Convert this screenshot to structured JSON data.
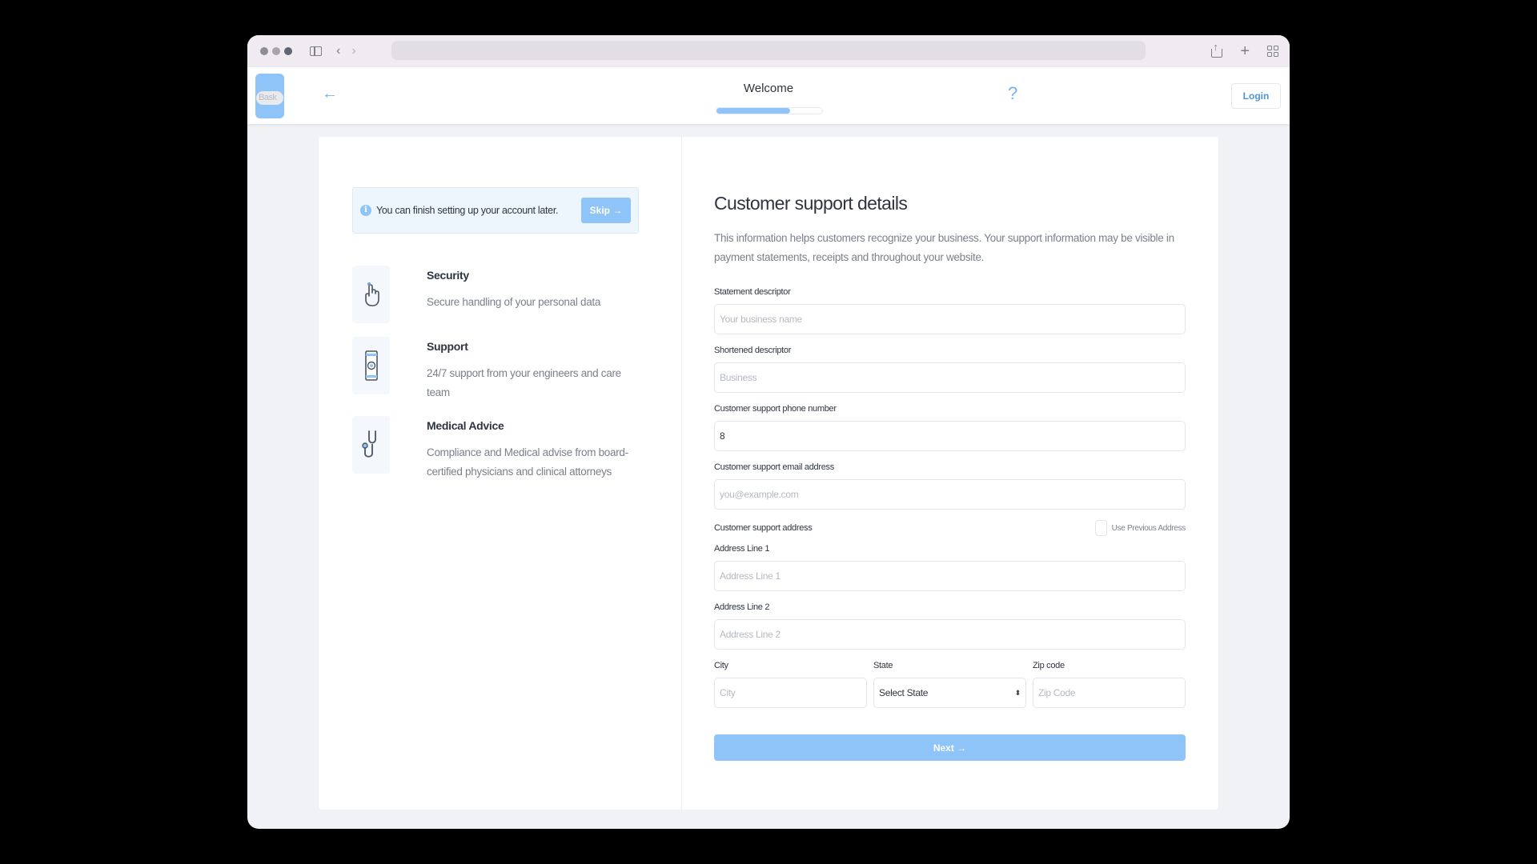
{
  "browser": {
    "toolbar_icons": [
      "sidebar-toggle-icon",
      "back-chevron-icon",
      "forward-chevron-icon",
      "share-icon",
      "new-tab-icon",
      "tab-overview-icon"
    ]
  },
  "header": {
    "logo_text": "Bask",
    "back_icon": "←",
    "title": "Welcome",
    "progress_percent": 70,
    "help_icon": "?",
    "login_label": "Login"
  },
  "left_panel": {
    "notice": {
      "icon": "i",
      "text": "You can finish setting up your account later.",
      "skip_label": "Skip →"
    },
    "features": [
      {
        "icon": "finger-touch-icon",
        "title": "Security",
        "description": "Secure handling of your personal data"
      },
      {
        "icon": "smartphone-icon",
        "title": "Support",
        "description": "24/7 support from your engineers and care team"
      },
      {
        "icon": "stethoscope-icon",
        "title": "Medical Advice",
        "description": "Compliance and Medical advise from board-certified physicians and clinical attorneys"
      }
    ]
  },
  "form": {
    "title": "Customer support details",
    "description": "This information helps customers recognize your business. Your support information may be visible in payment statements, receipts and throughout your website.",
    "statement_descriptor": {
      "label": "Statement descriptor",
      "placeholder": "Your business name",
      "value": ""
    },
    "shortened_descriptor": {
      "label": "Shortened descriptor",
      "placeholder": "Business",
      "value": ""
    },
    "phone": {
      "label": "Customer support phone number",
      "placeholder": "",
      "value": "8"
    },
    "email": {
      "label": "Customer support email address",
      "placeholder": "you@example.com",
      "value": ""
    },
    "address_section_label": "Customer support address",
    "use_previous_address": {
      "label": "Use Previous Address",
      "checked": false
    },
    "address_line_1": {
      "label": "Address Line 1",
      "placeholder": "Address Line 1",
      "value": ""
    },
    "address_line_2": {
      "label": "Address Line 2",
      "placeholder": "Address Line 2",
      "value": ""
    },
    "city": {
      "label": "City",
      "placeholder": "City",
      "value": ""
    },
    "state": {
      "label": "State",
      "selected": "Select State"
    },
    "zip": {
      "label": "Zip code",
      "placeholder": "Zip Code",
      "value": ""
    },
    "next_label": "Next →"
  }
}
